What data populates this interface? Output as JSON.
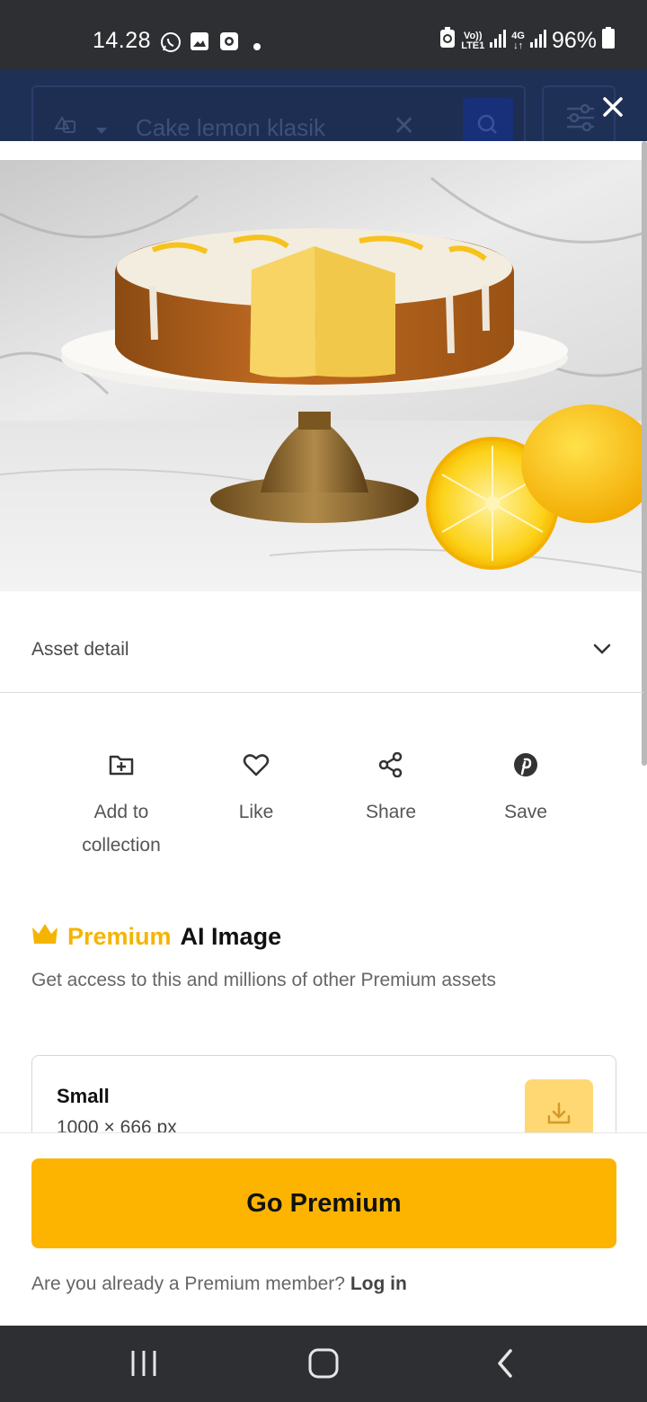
{
  "status_bar": {
    "time": "14.28",
    "battery": "96%",
    "net_volte": "Vo))",
    "net_lte": "LTE1",
    "net_4g": "4G"
  },
  "search": {
    "query": "Cake lemon klasik"
  },
  "asset": {
    "detail_label": "Asset detail"
  },
  "actions": [
    {
      "label": "Add to collection",
      "icon": "folder-plus-icon"
    },
    {
      "label": "Like",
      "icon": "heart-icon"
    },
    {
      "label": "Share",
      "icon": "share-icon"
    },
    {
      "label": "Save",
      "icon": "pinterest-icon"
    }
  ],
  "premium": {
    "badge": "Premium",
    "type": "AI Image",
    "subtitle": "Get access to this and millions of other Premium assets",
    "accent": "#f5b400"
  },
  "size_option": {
    "name": "Small",
    "dimensions": "1000 × 666 px"
  },
  "cta": {
    "button_label": "Go Premium",
    "member_question": "Are you already a Premium member?",
    "login_label": "Log in"
  }
}
